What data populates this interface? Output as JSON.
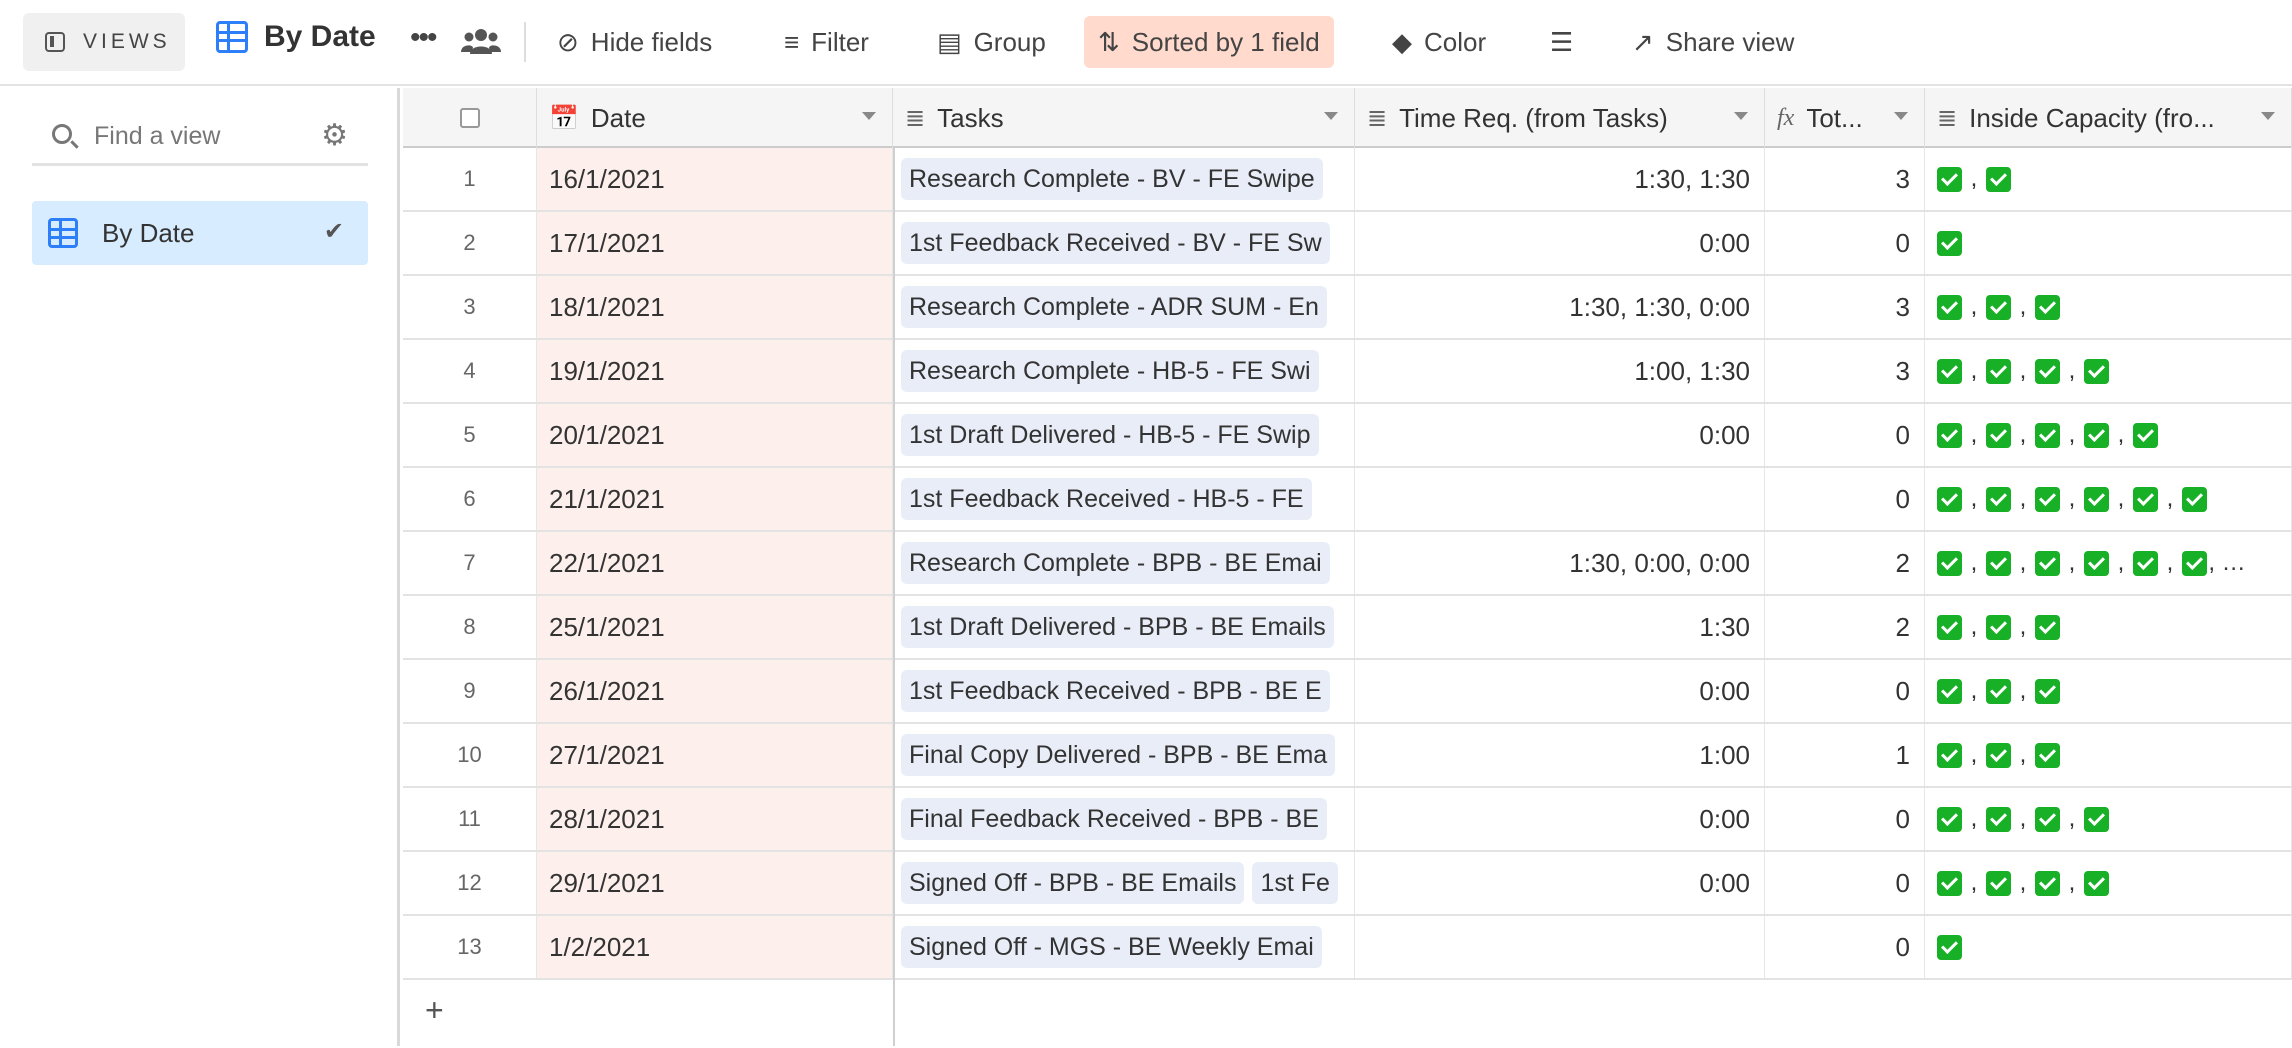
{
  "toolbar": {
    "views_label": "VIEWS",
    "view_title": "By Date",
    "hide_fields": "Hide fields",
    "filter": "Filter",
    "group": "Group",
    "sorted": "Sorted by 1 field",
    "color": "Color",
    "share_view": "Share view",
    "sorted_bg": "#ffdacd"
  },
  "sidebar": {
    "search_placeholder": "Find a view",
    "items": [
      {
        "label": "By Date",
        "selected": true
      }
    ]
  },
  "table": {
    "columns": [
      "Date",
      "Tasks",
      "Time Req. (from Tasks)",
      "Tot...",
      "Inside Capacity (fro..."
    ],
    "rows": [
      {
        "num": "1",
        "date": "16/1/2021",
        "tasks": [
          "Research Complete - BV - FE Swipe"
        ],
        "time": "1:30, 1:30",
        "total": "3",
        "inside": 2,
        "overflow": false
      },
      {
        "num": "2",
        "date": "17/1/2021",
        "tasks": [
          "1st Feedback Received - BV - FE Sw"
        ],
        "time": "0:00",
        "total": "0",
        "inside": 1,
        "overflow": false
      },
      {
        "num": "3",
        "date": "18/1/2021",
        "tasks": [
          "Research Complete - ADR SUM - En"
        ],
        "time": "1:30, 1:30, 0:00",
        "total": "3",
        "inside": 3,
        "overflow": false
      },
      {
        "num": "4",
        "date": "19/1/2021",
        "tasks": [
          "Research Complete - HB-5 - FE Swi"
        ],
        "time": "1:00, 1:30",
        "total": "3",
        "inside": 4,
        "overflow": false
      },
      {
        "num": "5",
        "date": "20/1/2021",
        "tasks": [
          "1st Draft Delivered - HB-5 - FE Swip"
        ],
        "time": "0:00",
        "total": "0",
        "inside": 5,
        "overflow": false
      },
      {
        "num": "6",
        "date": "21/1/2021",
        "tasks": [
          "1st Feedback Received - HB-5 - FE"
        ],
        "time": "",
        "total": "0",
        "inside": 6,
        "overflow": false
      },
      {
        "num": "7",
        "date": "22/1/2021",
        "tasks": [
          "Research Complete - BPB - BE Emai"
        ],
        "time": "1:30, 0:00, 0:00",
        "total": "2",
        "inside": 6,
        "overflow": true
      },
      {
        "num": "8",
        "date": "25/1/2021",
        "tasks": [
          "1st Draft Delivered - BPB - BE Emails"
        ],
        "time": "1:30",
        "total": "2",
        "inside": 3,
        "overflow": false
      },
      {
        "num": "9",
        "date": "26/1/2021",
        "tasks": [
          "1st Feedback Received - BPB - BE E"
        ],
        "time": "0:00",
        "total": "0",
        "inside": 3,
        "overflow": false
      },
      {
        "num": "10",
        "date": "27/1/2021",
        "tasks": [
          "Final Copy Delivered - BPB - BE Ema"
        ],
        "time": "1:00",
        "total": "1",
        "inside": 3,
        "overflow": false
      },
      {
        "num": "11",
        "date": "28/1/2021",
        "tasks": [
          "Final Feedback Received - BPB - BE"
        ],
        "time": "0:00",
        "total": "0",
        "inside": 4,
        "overflow": false
      },
      {
        "num": "12",
        "date": "29/1/2021",
        "tasks": [
          "Signed Off - BPB - BE Emails",
          "1st Fe"
        ],
        "time": "0:00",
        "total": "0",
        "inside": 4,
        "overflow": false
      },
      {
        "num": "13",
        "date": "1/2/2021",
        "tasks": [
          "Signed Off - MGS - BE Weekly Emai"
        ],
        "time": "",
        "total": "0",
        "inside": 1,
        "overflow": false
      }
    ]
  },
  "add_row": "+"
}
